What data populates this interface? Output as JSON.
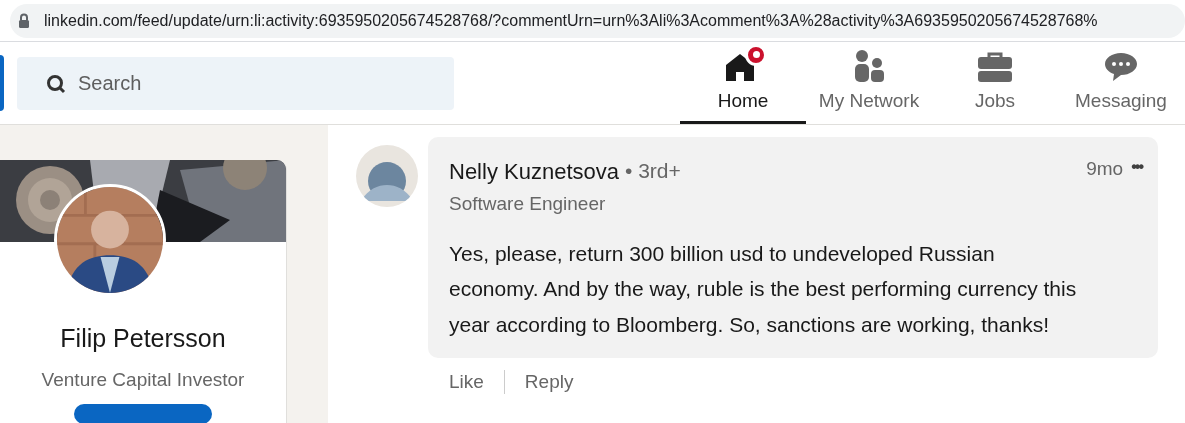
{
  "address_bar": {
    "url": "linkedin.com/feed/update/urn:li:activity:6935950205674528768/?commentUrn=urn%3Ali%3Acomment%3A%28activity%3A6935950205674528768%"
  },
  "search": {
    "placeholder": "Search"
  },
  "nav": [
    {
      "label": "Home",
      "kind": "home",
      "selected": true,
      "badge": true
    },
    {
      "label": "My Network",
      "kind": "network",
      "selected": false,
      "badge": false
    },
    {
      "label": "Jobs",
      "kind": "jobs",
      "selected": false,
      "badge": false
    },
    {
      "label": "Messaging",
      "kind": "messaging",
      "selected": false,
      "badge": false
    }
  ],
  "profile": {
    "name": "Filip Petersson",
    "headline": "Venture Capital Investor"
  },
  "comment": {
    "author": "Nelly Kuznetsova",
    "degree": "• 3rd+",
    "headline": "Software Engineer",
    "time": "9mo",
    "more": "•••",
    "text": "Yes, please, return 300 billion usd to undeveloped Russian economy. And by the way, ruble is the best performing currency this year according to Bloomberg. So, sanctions are working, thanks!",
    "actions": [
      "Like",
      "Reply"
    ]
  }
}
